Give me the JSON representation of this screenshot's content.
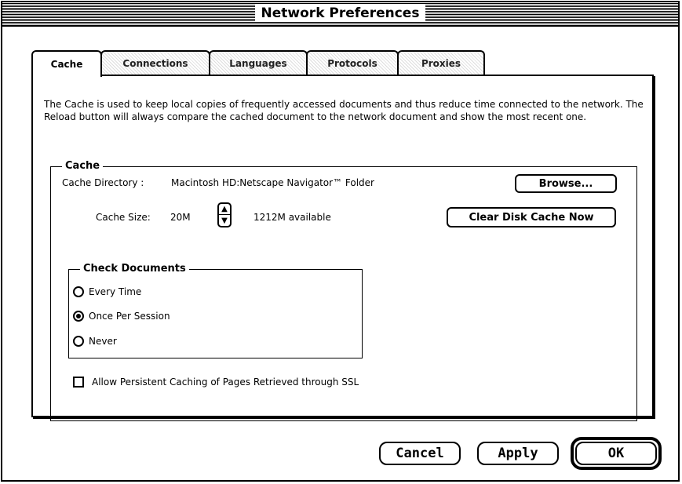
{
  "window": {
    "title": "Network Preferences"
  },
  "tabs": [
    {
      "label": "Cache",
      "active": true
    },
    {
      "label": "Connections",
      "active": false
    },
    {
      "label": "Languages",
      "active": false
    },
    {
      "label": "Protocols",
      "active": false
    },
    {
      "label": "Proxies",
      "active": false
    }
  ],
  "cache_tab": {
    "description": "The Cache is used to keep local copies of frequently accessed documents and thus reduce time connected to the network. The Reload button will always compare the cached document to the network document and show the most recent one.",
    "group_label": "Cache",
    "directory_label": "Cache Directory :",
    "directory_value": "Macintosh HD:Netscape Navigator™ Folder",
    "browse_label": "Browse...",
    "size_label": "Cache Size:",
    "size_value": "20M",
    "available_text": "1212M available",
    "clear_label": "Clear Disk Cache Now",
    "check_documents": {
      "label": "Check Documents",
      "options": [
        {
          "label": "Every Time",
          "selected": false
        },
        {
          "label": "Once Per Session",
          "selected": true
        },
        {
          "label": "Never",
          "selected": false
        }
      ]
    },
    "ssl_label": "Allow Persistent Caching of Pages Retrieved through SSL",
    "ssl_checked": false
  },
  "buttons": {
    "cancel": "Cancel",
    "apply": "Apply",
    "ok": "OK"
  }
}
